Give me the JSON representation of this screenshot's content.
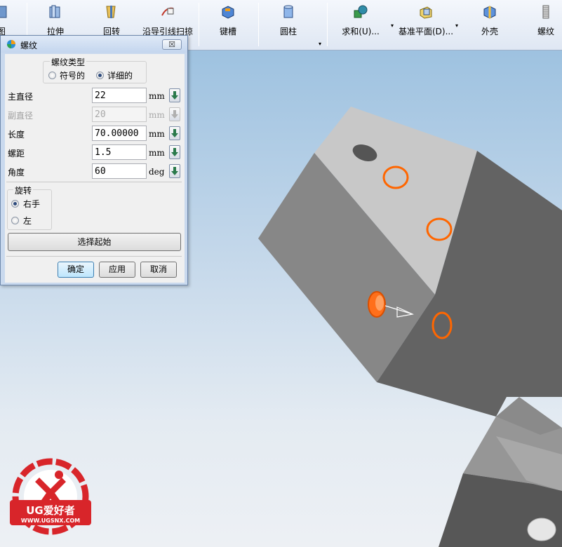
{
  "toolbar": {
    "items": [
      {
        "label": "图",
        "icon": "feature-icon"
      },
      {
        "label": "拉伸",
        "icon": "extrude-icon"
      },
      {
        "label": "回转",
        "icon": "revolve-icon"
      },
      {
        "label": "沿导引线扫掠",
        "icon": "sweep-along-guide-icon"
      },
      {
        "label": "键槽",
        "icon": "slot-icon"
      },
      {
        "label": "圆柱",
        "icon": "cylinder-icon"
      },
      {
        "label": "求和(U)...",
        "icon": "unite-icon"
      },
      {
        "label": "基准平面(D)...",
        "icon": "datum-plane-icon"
      },
      {
        "label": "外壳",
        "icon": "shell-icon"
      },
      {
        "label": "螺纹",
        "icon": "thread-icon"
      }
    ]
  },
  "dialog": {
    "title": "螺纹",
    "close_label": "☒",
    "thread_type": {
      "legend": "螺纹类型",
      "options": [
        "符号的",
        "详细的"
      ],
      "selected": "详细的"
    },
    "fields": [
      {
        "label": "主直径",
        "value": "22",
        "unit": "mm",
        "enabled": true
      },
      {
        "label": "副直径",
        "value": "20",
        "unit": "mm",
        "enabled": false
      },
      {
        "label": "长度",
        "value": "70.00000",
        "unit": "mm",
        "enabled": true
      },
      {
        "label": "螺距",
        "value": "1.5",
        "unit": "mm",
        "enabled": true
      },
      {
        "label": "角度",
        "value": "60",
        "unit": "deg",
        "enabled": true
      }
    ],
    "rotation": {
      "legend": "旋转",
      "options": [
        "右手",
        "左"
      ],
      "selected": "右手"
    },
    "select_start_label": "选择起始",
    "ok_label": "确定",
    "apply_label": "应用",
    "cancel_label": "取消"
  },
  "watermark": {
    "brand": "UG爱好者",
    "url": "WWW.UGSNX.COM"
  },
  "colors": {
    "highlight": "#ff6600",
    "logo_red": "#d8252a"
  }
}
